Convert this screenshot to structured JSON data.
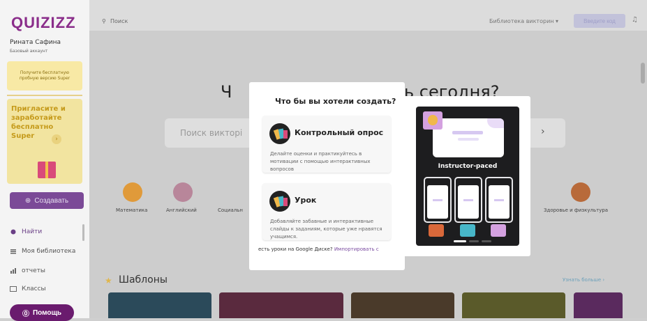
{
  "app": {
    "logo": "QUIZIZZ"
  },
  "user": {
    "name": "Рината Сафина",
    "account_type": "Базовый аккаунт"
  },
  "sidebar": {
    "upgrade_text": "Получите бесплатную пробную версию Super",
    "invite_text": "Пригласите и заработайте бесплатно Super",
    "invite_arrow": "›",
    "create_label": "Создавать",
    "nav": [
      {
        "label": "Найти"
      },
      {
        "label": "Моя библиотека"
      },
      {
        "label": "отчеты"
      },
      {
        "label": "Классы"
      }
    ],
    "help_label": "Помощь"
  },
  "topbar": {
    "search_placeholder": "Поиск",
    "library_dropdown": "Библиотека викторин ▾",
    "enter_code": "Введите код"
  },
  "main": {
    "hero_left": "Ч",
    "hero_right": "ть сегодня?",
    "search_placeholder": "Поиск викторі",
    "subjects": [
      {
        "label": "Математика"
      },
      {
        "label": "Английский"
      },
      {
        "label": "Социальн"
      },
      {
        "label": "Здоровье и физкультура"
      }
    ],
    "templates_title": "Шаблоны",
    "see_more": "Узнать больше ›"
  },
  "modal": {
    "title": "Что бы вы хотели создать?",
    "options": [
      {
        "title": "Контрольный опрос",
        "description": "Делайте оценки и практикуйтесь в мотивации с помощью интерактивных вопросов"
      },
      {
        "title": "Урок",
        "description": "Добавляйте забавные и интерактивные слайды к заданиям, которые уже нравятся учащимся."
      }
    ],
    "footer_text": "есть уроки на Google Диске?",
    "footer_link": "Импортировать с"
  },
  "preview": {
    "label": "Instructor-paced"
  },
  "colors": {
    "brand": "#8a2d8a",
    "accent": "#7a4ba0",
    "help": "#6a1b6e"
  }
}
